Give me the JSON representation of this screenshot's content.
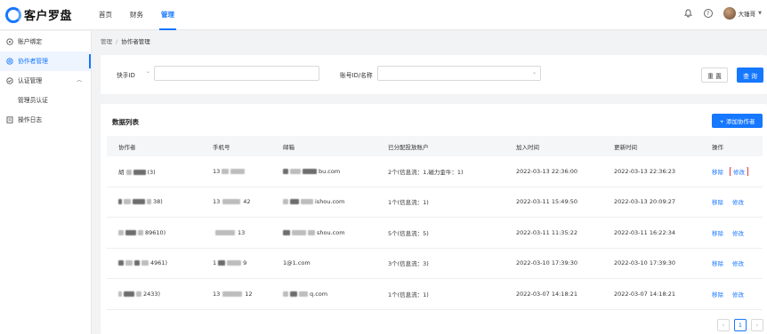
{
  "app": {
    "logo_text": "客户罗盘"
  },
  "nav": [
    {
      "label": "首页"
    },
    {
      "label": "财务"
    },
    {
      "label": "管理"
    }
  ],
  "user": {
    "name": "大锤哥",
    "help_glyph": "?",
    "bell_icon": "bell-icon"
  },
  "sidebar": {
    "items": [
      {
        "label": "账户绑定",
        "icon": "link-icon"
      },
      {
        "label": "协作者管理",
        "icon": "settings-icon"
      },
      {
        "label": "认证管理",
        "icon": "check-circle-icon"
      },
      {
        "label": "管理员认证"
      },
      {
        "label": "操作日志",
        "icon": "log-icon"
      }
    ]
  },
  "breadcrumb": {
    "parent": "管理",
    "separator": "/",
    "current": "协作者管理"
  },
  "filter": {
    "field1_label": "快手ID",
    "field2_label": "账号ID/名称",
    "reset_label": "重 置",
    "search_label": "查 询"
  },
  "list": {
    "title": "数据列表",
    "add_label": "+ 添加协作者",
    "columns": [
      "协作者",
      "手机号",
      "邮箱",
      "已分配投放账户",
      "加入时间",
      "更新时间",
      "操作"
    ],
    "rows": [
      {
        "collab_a": "胡",
        "collab_b": "(3)",
        "phone_a": "13",
        "email_end": "bu.com",
        "accounts": "2个(信息流：1,磁力金牛：1)",
        "joined": "2022-03-13 22:36:00",
        "updated": "2022-03-13 22:36:23"
      },
      {
        "collab_a": "",
        "collab_b": "38)",
        "phone_a": "13",
        "phone_b": "42",
        "email_end": "ishou.com",
        "accounts": "1个(信息流：1)",
        "joined": "2022-03-11 15:49:50",
        "updated": "2022-03-13 20:09:27"
      },
      {
        "collab_a": "",
        "collab_b": "89610)",
        "phone_a": "",
        "phone_b": "13",
        "email_end": "shou.com",
        "accounts": "5个(信息流：5)",
        "joined": "2022-03-11 11:35:22",
        "updated": "2022-03-11 16:22:34"
      },
      {
        "collab_a": "",
        "collab_b": "4961)",
        "phone_a": "1",
        "phone_b": "9",
        "email_end": "1@1.com",
        "accounts": "3个(信息流：3)",
        "joined": "2022-03-10 17:39:30",
        "updated": "2022-03-10 17:39:30"
      },
      {
        "collab_a": "",
        "collab_b": "2433)",
        "phone_a": "13",
        "phone_b": "12",
        "email_end": "q.com",
        "accounts": "1个(信息流：1)",
        "joined": "2022-03-07 14:18:21",
        "updated": "2022-03-07 14:18:21"
      }
    ],
    "remove_label": "移除",
    "edit_label": "修改"
  },
  "pager": {
    "prev": "‹",
    "current": "1",
    "next": "›"
  },
  "colors": {
    "primary": "#1677ff",
    "highlight": "#e03a3a"
  }
}
